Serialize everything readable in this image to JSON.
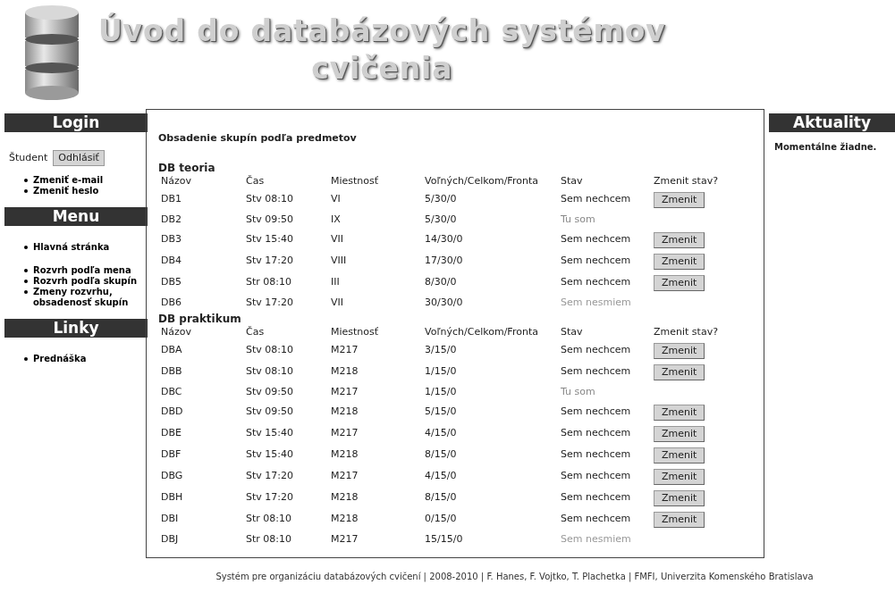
{
  "header": {
    "title_lines": [
      "Úvod do databázových systémov",
      "cvičenia"
    ]
  },
  "left_sidebar": {
    "sections": [
      {
        "heading": "Login",
        "kind": "login",
        "user": "Študent",
        "button": "Odhlásiť",
        "groups": [
          [
            "Zmeniť e-mail",
            "Zmeniť heslo"
          ]
        ]
      },
      {
        "heading": "Menu",
        "kind": "links",
        "groups": [
          [
            "Hlavná stránka"
          ],
          [
            "Rozvrh podľa mena",
            "Rozvrh podľa skupín",
            "Zmeny rozvrhu, obsadenosť skupín"
          ]
        ]
      },
      {
        "heading": "Linky",
        "kind": "links",
        "groups": [
          [
            "Prednáška"
          ]
        ]
      }
    ]
  },
  "main": {
    "title": "Obsadenie skupín podľa predmetov",
    "subjects": [
      {
        "name": "DB teoria",
        "columns": [
          "Názov",
          "Čas",
          "Miestnosť",
          "Voľných/Celkom/Fronta",
          "Stav",
          "Zmenit stav?"
        ],
        "rows": [
          {
            "cells": [
              "DB1",
              "Stv 08:10",
              "VI",
              "5/30/0"
            ],
            "status": "Sem nechcem",
            "kind": "open",
            "button": "Zmenit"
          },
          {
            "cells": [
              "DB2",
              "Stv 09:50",
              "IX",
              "5/30/0"
            ],
            "status": "Tu som",
            "kind": "member"
          },
          {
            "cells": [
              "DB3",
              "Stv 15:40",
              "VII",
              "14/30/0"
            ],
            "status": "Sem nechcem",
            "kind": "open",
            "button": "Zmenit"
          },
          {
            "cells": [
              "DB4",
              "Stv 17:20",
              "VIII",
              "17/30/0"
            ],
            "status": "Sem nechcem",
            "kind": "open",
            "button": "Zmenit"
          },
          {
            "cells": [
              "DB5",
              "Str 08:10",
              "III",
              "8/30/0"
            ],
            "status": "Sem nechcem",
            "kind": "open",
            "button": "Zmenit"
          },
          {
            "cells": [
              "DB6",
              "Stv 17:20",
              "VII",
              "30/30/0"
            ],
            "status": "Sem nesmiem",
            "kind": "full"
          }
        ]
      },
      {
        "name": "DB praktikum",
        "columns": [
          "Názov",
          "Čas",
          "Miestnosť",
          "Voľných/Celkom/Fronta",
          "Stav",
          "Zmenit stav?"
        ],
        "rows": [
          {
            "cells": [
              "DBA",
              "Stv 08:10",
              "M217",
              "3/15/0"
            ],
            "status": "Sem nechcem",
            "kind": "open",
            "button": "Zmenit"
          },
          {
            "cells": [
              "DBB",
              "Stv 08:10",
              "M218",
              "1/15/0"
            ],
            "status": "Sem nechcem",
            "kind": "open",
            "button": "Zmenit"
          },
          {
            "cells": [
              "DBC",
              "Stv 09:50",
              "M217",
              "1/15/0"
            ],
            "status": "Tu som",
            "kind": "member"
          },
          {
            "cells": [
              "DBD",
              "Stv 09:50",
              "M218",
              "5/15/0"
            ],
            "status": "Sem nechcem",
            "kind": "open",
            "button": "Zmenit"
          },
          {
            "cells": [
              "DBE",
              "Stv 15:40",
              "M217",
              "4/15/0"
            ],
            "status": "Sem nechcem",
            "kind": "open",
            "button": "Zmenit"
          },
          {
            "cells": [
              "DBF",
              "Stv 15:40",
              "M218",
              "8/15/0"
            ],
            "status": "Sem nechcem",
            "kind": "open",
            "button": "Zmenit"
          },
          {
            "cells": [
              "DBG",
              "Stv 17:20",
              "M217",
              "4/15/0"
            ],
            "status": "Sem nechcem",
            "kind": "open",
            "button": "Zmenit"
          },
          {
            "cells": [
              "DBH",
              "Stv 17:20",
              "M218",
              "8/15/0"
            ],
            "status": "Sem nechcem",
            "kind": "open",
            "button": "Zmenit"
          },
          {
            "cells": [
              "DBI",
              "Str 08:10",
              "M218",
              "0/15/0"
            ],
            "status": "Sem nechcem",
            "kind": "open",
            "button": "Zmenit"
          },
          {
            "cells": [
              "DBJ",
              "Str 08:10",
              "M217",
              "15/15/0"
            ],
            "status": "Sem nesmiem",
            "kind": "full"
          }
        ]
      }
    ]
  },
  "right_sidebar": {
    "heading": "Aktuality",
    "text": "Momentálne žiadne."
  },
  "footer": "Systém pre organizáciu databázových cvičení | 2008-2010 | F. Hanes, F. Vojtko, T. Plachetka | FMFI, Univerzita Komenského Bratislava"
}
